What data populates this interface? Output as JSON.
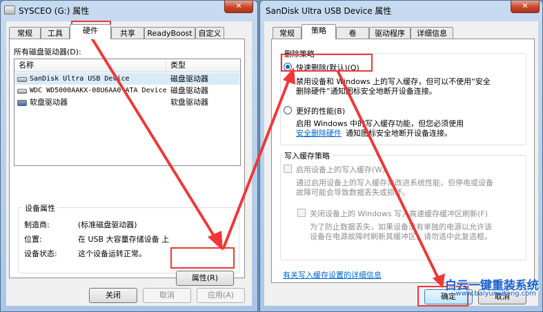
{
  "left_dialog": {
    "title": "SYSCEO (G:) 属性",
    "close_glyph": "✕",
    "tabs": [
      "常规",
      "工具",
      "硬件",
      "共享",
      "ReadyBoost",
      "自定义"
    ],
    "active_tab": "硬件",
    "list_label": "所有磁盘驱动器(D):",
    "columns": [
      "名称",
      "类型"
    ],
    "rows": [
      {
        "name": "SanDisk Ultra USB Device",
        "type": "磁盘驱动器"
      },
      {
        "name": "WDC WD5000AAKX-08U6AA0 ATA Device",
        "type": "磁盘驱动器"
      },
      {
        "name": "软盘驱动器",
        "type": "软盘驱动器"
      }
    ],
    "props_group": "设备属性",
    "manufacturer_label": "制造商:",
    "manufacturer_value": "(标准磁盘驱动器)",
    "location_label": "位置:",
    "location_value": "在 USB 大容量存储设备 上",
    "status_label": "设备状态:",
    "status_value": "这个设备运转正常。",
    "properties_button": "属性(R)",
    "close_button": "关闭",
    "cancel_button": "取消",
    "apply_button": "应用(A)"
  },
  "right_dialog": {
    "title": "SanDisk Ultra USB Device 属性",
    "close_glyph": "✕",
    "tabs": [
      "常规",
      "策略",
      "卷",
      "驱动程序",
      "详细信息"
    ],
    "active_tab": "策略",
    "removal_group": "删除策略",
    "quick_removal_label": "快速删除(默认)(Q)",
    "quick_removal_desc_1": "禁用设备和 Windows 上的写入缓存，但可以不使用“安全",
    "quick_removal_desc_2": "删除硬件”通知图标安全地断开设备连接。",
    "better_perf_label": "更好的性能(B)",
    "better_perf_desc_1": "启用 Windows 中的写入缓存功能，但您必须使用",
    "better_perf_link": "安全删除硬件",
    "better_perf_desc_2": "通知图标安全地断开设备连接。",
    "write_cache_group": "写入缓存策略",
    "enable_cache_label": "启用设备上的写入缓存(W)",
    "enable_cache_desc_1": "通过启用设备上的写入缓存来改进系统性能，但停电或设备",
    "enable_cache_desc_2": "故障可能会导致数据丢失或损坏。",
    "disable_flush_label": "关闭设备上的 Windows 写入高速缓存缓冲区刷新(F)",
    "disable_flush_desc_1": "为了防止数据丢失，如果设备没有单独的电源以允许该",
    "disable_flush_desc_2": "设备在电源故障时刷新其缓冲区，请勿选中此复选框。",
    "details_link": "有关写入缓存设置的详细信息",
    "ok_button": "确定",
    "cancel_button": "取消"
  },
  "watermark": {
    "brand": "白云一键重装系统",
    "url": "www.baiyunxitong.com"
  },
  "colors": {
    "annotation_red": "#ef3737",
    "link_blue": "#0066cc",
    "title_bar": "#c7daf0"
  }
}
